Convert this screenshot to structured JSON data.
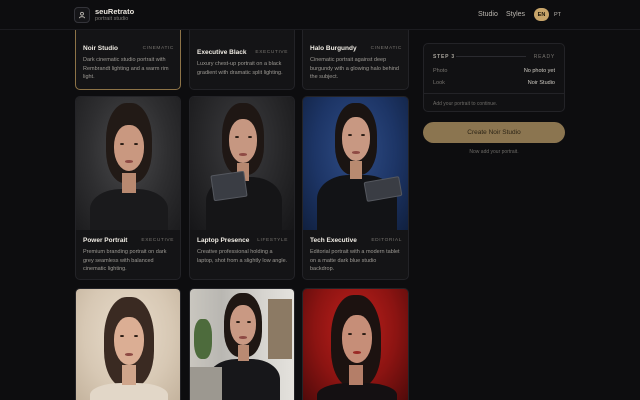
{
  "header": {
    "brand": "seuRetrato",
    "tagline": "portrait studio",
    "logo_icon": "person-icon",
    "nav": [
      "Studio",
      "Styles"
    ],
    "languages": [
      "EN",
      "PT"
    ],
    "active_language": "EN"
  },
  "cards": [
    {
      "title": "Noir Studio",
      "tag": "CINEMATIC",
      "desc": "Dark cinematic studio portrait with Rembrandt lighting and a warm rim light.",
      "selected": true
    },
    {
      "title": "Executive Black",
      "tag": "EXECUTIVE",
      "desc": "Luxury chest-up portrait on a black gradient with dramatic split lighting."
    },
    {
      "title": "Halo Burgundy",
      "tag": "CINEMATIC",
      "desc": "Cinematic portrait against deep burgundy with a glowing halo behind the subject."
    },
    {
      "title": "Power Portrait",
      "tag": "EXECUTIVE",
      "desc": "Premium branding portrait on dark grey seamless with balanced cinematic lighting."
    },
    {
      "title": "Laptop Presence",
      "tag": "LIFESTYLE",
      "desc": "Creative professional holding a laptop, shot from a slightly low angle."
    },
    {
      "title": "Tech Executive",
      "tag": "EDITORIAL",
      "desc": "Editorial portrait with a modern tablet on a matte dark blue studio backdrop."
    },
    {
      "title": "",
      "tag": "",
      "desc": ""
    },
    {
      "title": "",
      "tag": "",
      "desc": ""
    },
    {
      "title": "",
      "tag": "",
      "desc": ""
    }
  ],
  "panel": {
    "step": "STEP 3",
    "status": "READY",
    "rows": [
      {
        "key": "Photo",
        "value": "No photo yet"
      },
      {
        "key": "Look",
        "value": "Noir Studio"
      }
    ],
    "hint": "Add your portrait to continue.",
    "cta": "Create Noir Studio",
    "cta_sub": "Now add your portrait."
  }
}
